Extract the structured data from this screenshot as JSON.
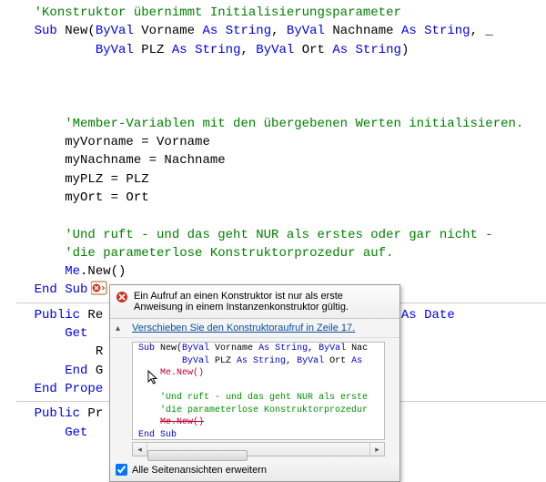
{
  "code": {
    "c1": "'Konstruktor übernimmt Initialisierungsparameter",
    "l2a": "Sub",
    "l2b": " New(",
    "l2c": "ByVal",
    "l2d": " Vorname ",
    "l2e": "As String",
    "l2f": ", ",
    "l2g": "ByVal",
    "l2h": " Nachname ",
    "l2i": "As String",
    "l2j": ", _",
    "l3a": "ByVal",
    "l3b": " PLZ ",
    "l3c": "As String",
    "l3d": ", ",
    "l3e": "ByVal",
    "l3f": " Ort ",
    "l3g": "As String",
    "l3h": ")",
    "c4": "'Member-Variablen mit den übergebenen Werten initialisieren.",
    "l5": "myVorname = Vorname",
    "l6": "myNachname = Nachname",
    "l7": "myPLZ = PLZ",
    "l8": "myOrt = Ort",
    "c9": "'Und ruft - und das geht NUR als erstes oder gar nicht -",
    "c10": "'die parameterlose Konstruktorprozedur auf.",
    "l11a": "Me",
    "l11b": ".New()",
    "l12": "End Sub",
    "l13a": "Public",
    "l13b": " Re",
    "l13c": "As Date",
    "l14": "Get",
    "l15": "R",
    "l16a": "End",
    "l16b": " G",
    "l17": "End Prope",
    "l18a": "Public",
    "l18b": " Pr",
    "l19": "Get"
  },
  "popup": {
    "header": "Ein Aufruf an einen Konstruktor ist nur als erste Anweisung in einem Instanzenkonstruktor gültig.",
    "fix_link": "Verschieben Sie den Konstruktoraufruf in Zeile 17.",
    "checkbox_label": "Alle Seitenansichten erweitern"
  },
  "preview": {
    "p1a": "Sub",
    "p1b": " New(",
    "p1c": "ByVal",
    "p1d": " Vorname ",
    "p1e": "As String",
    "p1f": ", ",
    "p1g": "ByVal",
    "p1h": " Nac",
    "p2a": "ByVal",
    "p2b": " PLZ ",
    "p2c": "As String",
    "p2d": ", ",
    "p2e": "ByVal",
    "p2f": " Ort ",
    "p2g": "As",
    "p3": "Me.New()",
    "p4": "'Und ruft - und das geht NUR als erste",
    "p5": "'die parameterlose Konstruktorprozedur",
    "p6": "Me.New()",
    "p7": "End Sub"
  }
}
